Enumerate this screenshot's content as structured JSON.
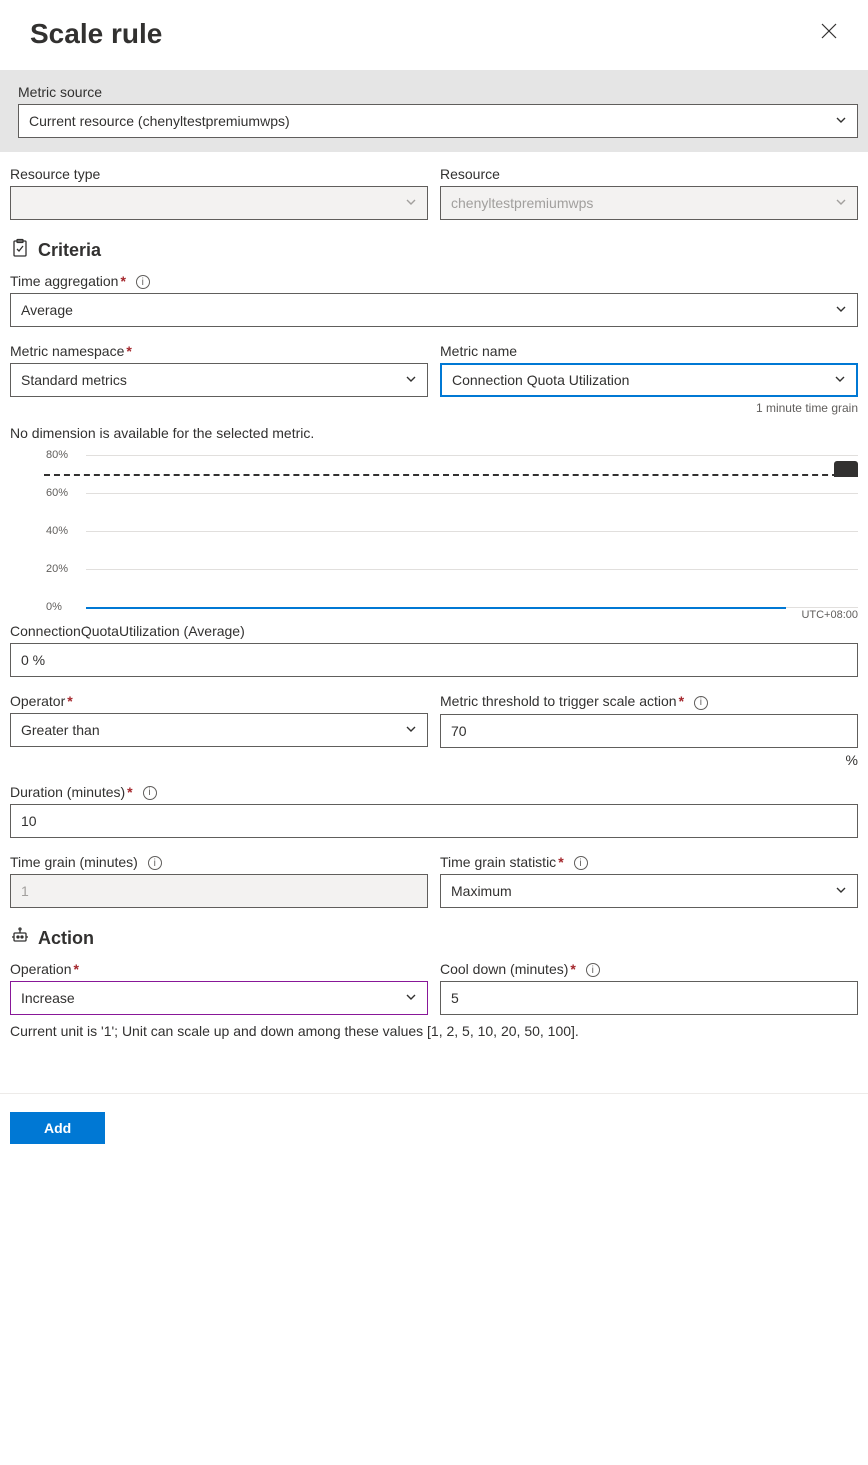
{
  "title": "Scale rule",
  "metric_source": {
    "label": "Metric source",
    "value": "Current resource (chenyltestpremiumwps)"
  },
  "resource_type": {
    "label": "Resource type",
    "value": ""
  },
  "resource": {
    "label": "Resource",
    "value": "chenyltestpremiumwps"
  },
  "criteria": {
    "heading": "Criteria",
    "time_aggregation": {
      "label": "Time aggregation",
      "value": "Average"
    },
    "metric_namespace": {
      "label": "Metric namespace",
      "value": "Standard metrics"
    },
    "metric_name": {
      "label": "Metric name",
      "value": "Connection Quota Utilization",
      "grain_note": "1 minute time grain"
    },
    "no_dimension": "No dimension is available for the selected metric.",
    "connection_quota": {
      "label": "ConnectionQuotaUtilization (Average)",
      "value": "0 %"
    },
    "operator": {
      "label": "Operator",
      "value": "Greater than"
    },
    "threshold": {
      "label": "Metric threshold to trigger scale action",
      "value": "70",
      "unit": "%"
    },
    "duration": {
      "label": "Duration (minutes)",
      "value": "10"
    },
    "time_grain": {
      "label": "Time grain (minutes)",
      "value": "1"
    },
    "time_grain_stat": {
      "label": "Time grain statistic",
      "value": "Maximum"
    }
  },
  "action": {
    "heading": "Action",
    "operation": {
      "label": "Operation",
      "value": "Increase"
    },
    "cooldown": {
      "label": "Cool down (minutes)",
      "value": "5"
    },
    "hint": "Current unit is '1'; Unit can scale up and down among these values [1, 2, 5, 10, 20, 50, 100]."
  },
  "footer": {
    "add": "Add"
  },
  "chart_data": {
    "type": "line",
    "title": "",
    "xlabel": "",
    "ylabel": "",
    "ylim": [
      0,
      80
    ],
    "y_ticks": [
      "0%",
      "20%",
      "40%",
      "60%",
      "80%"
    ],
    "threshold": 70,
    "tz": "UTC+08:00",
    "series": [
      {
        "name": "ConnectionQuotaUtilization (Average)",
        "value": 0
      }
    ]
  }
}
